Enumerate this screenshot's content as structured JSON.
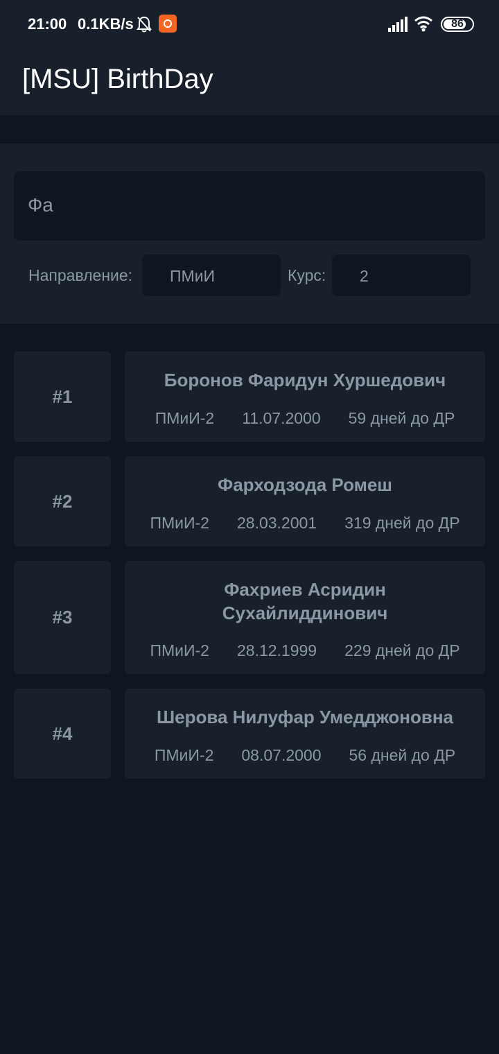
{
  "status_bar": {
    "time": "21:00",
    "speed": "0.1KB/s",
    "battery": "86",
    "icons": [
      "bell-muted-icon",
      "app-notification-icon",
      "signal-icon",
      "wifi-icon",
      "battery-icon"
    ]
  },
  "app_bar": {
    "title": "[MSU] BirthDay"
  },
  "filters": {
    "search_value": "Фа",
    "direction_label": "Направление:",
    "direction_value": "ПМиИ",
    "course_label": "Курс:",
    "course_value": "2"
  },
  "students": [
    {
      "number": "#1",
      "name": "Боронов Фаридун Хуршедович",
      "group": "ПМиИ-2",
      "date": "11.07.2000",
      "days": "59 дней до ДР"
    },
    {
      "number": "#2",
      "name": "Фарходзода Ромеш",
      "group": "ПМиИ-2",
      "date": "28.03.2001",
      "days": "319 дней до ДР"
    },
    {
      "number": "#3",
      "name": "Фахриев Асридин Сухайлиддинович",
      "group": "ПМиИ-2",
      "date": "28.12.1999",
      "days": "229 дней до ДР"
    },
    {
      "number": "#4",
      "name": "Шерова Нилуфар Умедджоновна",
      "group": "ПМиИ-2",
      "date": "08.07.2000",
      "days": "56 дней до ДР"
    }
  ]
}
